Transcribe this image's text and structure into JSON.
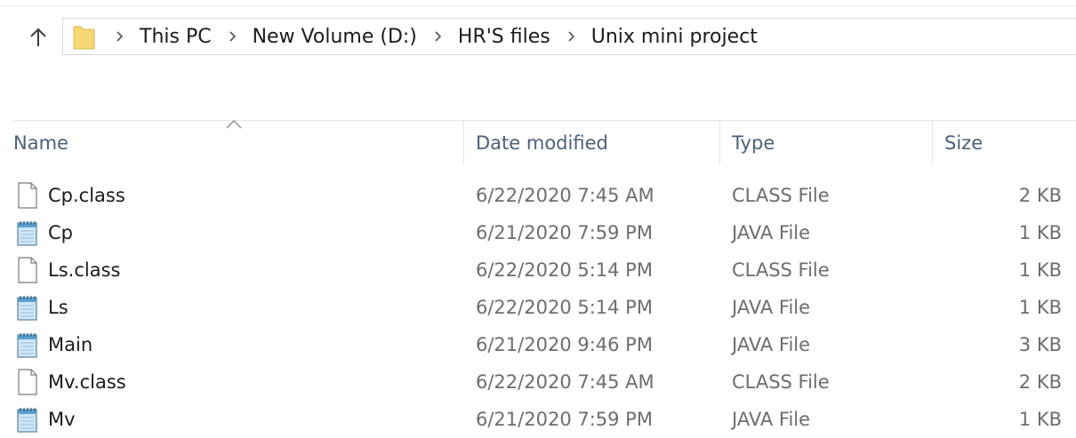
{
  "breadcrumb": {
    "items": [
      "This PC",
      "New Volume (D:)",
      "HR'S files",
      "Unix mini project"
    ]
  },
  "columns": {
    "name": "Name",
    "date": "Date modified",
    "type": "Type",
    "size": "Size"
  },
  "files": [
    {
      "name": "Cp.class",
      "date": "6/22/2020 7:45 AM",
      "type": "CLASS File",
      "size": "2 KB",
      "icon": "blank-file-icon"
    },
    {
      "name": "Cp",
      "date": "6/21/2020 7:59 PM",
      "type": "JAVA File",
      "size": "1 KB",
      "icon": "notepad-file-icon"
    },
    {
      "name": "Ls.class",
      "date": "6/22/2020 5:14 PM",
      "type": "CLASS File",
      "size": "1 KB",
      "icon": "blank-file-icon"
    },
    {
      "name": "Ls",
      "date": "6/22/2020 5:14 PM",
      "type": "JAVA File",
      "size": "1 KB",
      "icon": "notepad-file-icon"
    },
    {
      "name": "Main",
      "date": "6/21/2020 9:46 PM",
      "type": "JAVA File",
      "size": "3 KB",
      "icon": "notepad-file-icon"
    },
    {
      "name": "Mv.class",
      "date": "6/22/2020 7:45 AM",
      "type": "CLASS File",
      "size": "2 KB",
      "icon": "blank-file-icon"
    },
    {
      "name": "Mv",
      "date": "6/21/2020 7:59 PM",
      "type": "JAVA File",
      "size": "1 KB",
      "icon": "notepad-file-icon"
    }
  ],
  "colors": {
    "folder": "#f8d775",
    "header_text": "#4c607a",
    "detail_text": "#6d6d6d"
  }
}
